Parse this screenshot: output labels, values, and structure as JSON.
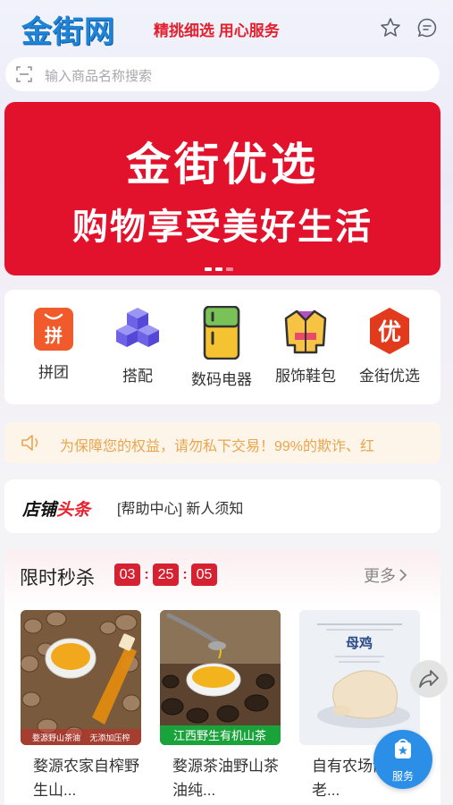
{
  "header": {
    "logo": "金街网",
    "slogan": "精挑细选 用心服务",
    "favorite_icon": "star-icon",
    "message_icon": "chat-bubble-icon"
  },
  "search": {
    "placeholder": "输入商品名称搜索",
    "icon": "scan-icon"
  },
  "banner": {
    "title": "金街优选",
    "subtitle": "购物享受美好生活",
    "slide_count": 3,
    "active_slide": 1
  },
  "categories": [
    {
      "label": "拼团",
      "icon": "group-buy-bag-icon",
      "glyph": "拼"
    },
    {
      "label": "搭配",
      "icon": "cubes-icon"
    },
    {
      "label": "数码电器",
      "icon": "fridge-icon"
    },
    {
      "label": "服饰鞋包",
      "icon": "jacket-icon"
    },
    {
      "label": "金街优选",
      "icon": "you-select-icon",
      "glyph": "优"
    }
  ],
  "notice": {
    "text": "为保障您的权益，请勿私下交易！99%的欺诈、红",
    "icon": "speaker-icon"
  },
  "headline": {
    "logo_part1": "店铺",
    "logo_part2": "头条",
    "text": "[帮助中心] 新人须知"
  },
  "flash_sale": {
    "title": "限时秒杀",
    "timer": {
      "hours": "03",
      "minutes": "25",
      "seconds": "05"
    },
    "more_label": "更多",
    "products": [
      {
        "name": "婺源农家自榨野生山...",
        "image_caption_left": "婺源野山茶油",
        "image_caption_right": "无添加压榨"
      },
      {
        "name": "婺源茶油野山茶油纯...",
        "image_caption": "江西野生有机山茶"
      },
      {
        "name": "自有农场散养老...",
        "image_caption": "母鸡"
      }
    ]
  },
  "floating": {
    "share_icon": "share-icon",
    "service_label": "服务",
    "service_icon": "service-bag-icon"
  },
  "colors": {
    "brand_red": "#e3122c",
    "logo_blue": "#1f83d6",
    "notice_orange": "#e8a64f",
    "service_blue": "#2b8fe8"
  }
}
